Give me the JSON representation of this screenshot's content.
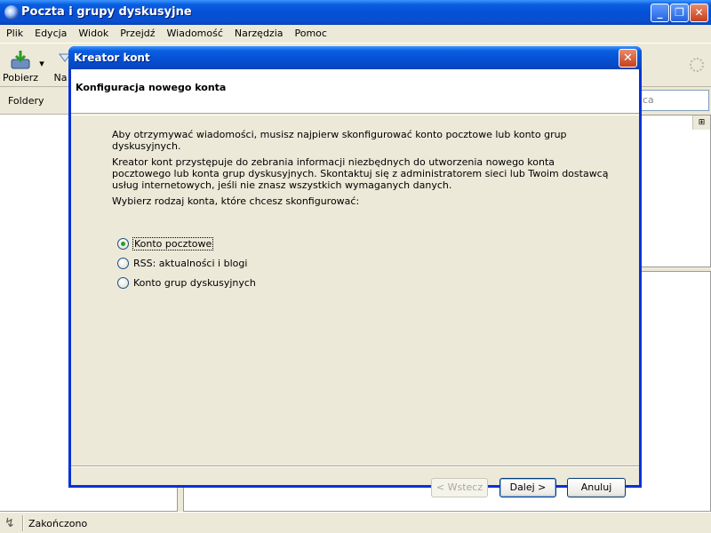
{
  "window": {
    "title": "Poczta i grupy dyskusyjne",
    "controls": {
      "minimize": "_",
      "maximize": "❐",
      "close": "✕"
    }
  },
  "menu": [
    "Plik",
    "Edycja",
    "Widok",
    "Przejdź",
    "Wiadomość",
    "Narzędzia",
    "Pomoc"
  ],
  "toolbar": {
    "get_label": "Pobierz",
    "dropdown_arrow": "▾",
    "write_label": "Na"
  },
  "folders_label": "Foldery",
  "search_placeholder": "ca",
  "column_picker": "⊞",
  "status": {
    "icon": "↯",
    "text": "Zakończono"
  },
  "dialog": {
    "title": "Kreator kont",
    "close": "✕",
    "heading": "Konfiguracja nowego konta",
    "intro": "Aby otrzymywać wiadomości, musisz najpierw skonfigurować konto pocztowe lub konto grup dyskusyjnych.",
    "description": "Kreator kont przystępuje do zebrania informacji niezbędnych do utworzenia nowego konta pocztowego lub konta grup dyskusyjnych. Skontaktuj się z administratorem sieci lub Twoim dostawcą usług internetowych, jeśli nie znasz wszystkich wymaganych danych.",
    "prompt": "Wybierz rodzaj konta, które chcesz skonfigurować:",
    "options": [
      {
        "label": "Konto pocztowe",
        "checked": true
      },
      {
        "label": "RSS: aktualności i blogi",
        "checked": false
      },
      {
        "label": "Konto grup dyskusyjnych",
        "checked": false
      }
    ],
    "buttons": {
      "back": "< Wstecz",
      "next": "Dalej >",
      "cancel": "Anuluj"
    }
  },
  "colors": {
    "xp_blue": "#0551d6",
    "window_bg": "#ece9d8",
    "radio_check": "#21a121",
    "close_red": "#c5401c"
  }
}
